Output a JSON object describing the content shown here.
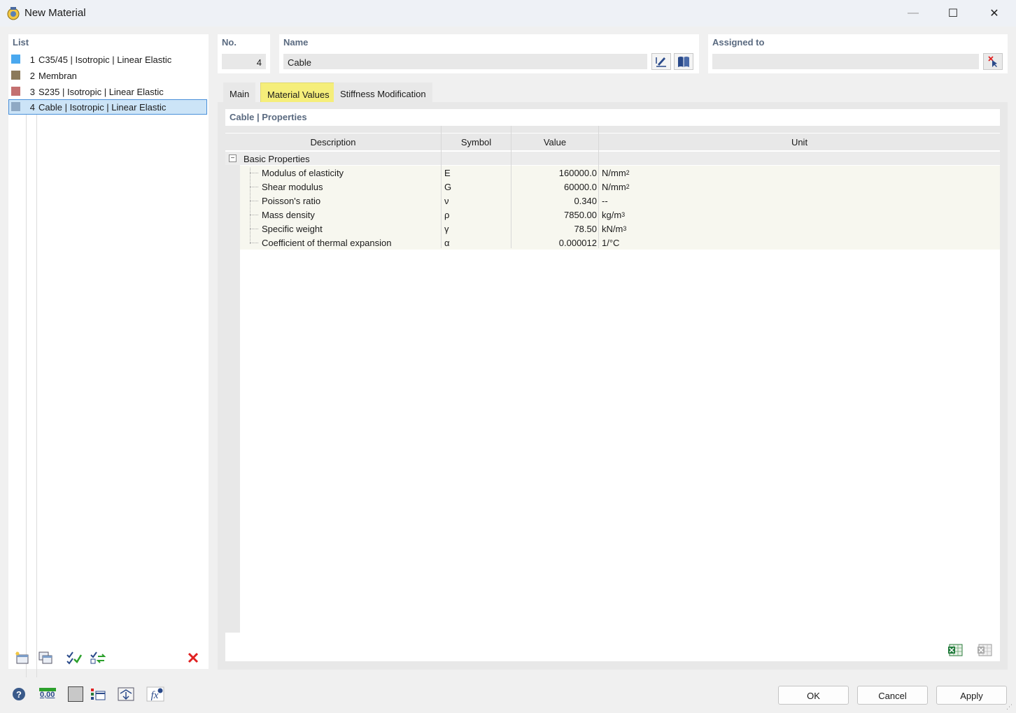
{
  "window": {
    "title": "New Material",
    "minimize": "—",
    "maximize": "☐",
    "close": "✕"
  },
  "list": {
    "label": "List",
    "items": [
      {
        "num": "1",
        "label": "C35/45 | Isotropic | Linear Elastic",
        "color": "#4aa8ef"
      },
      {
        "num": "2",
        "label": "Membran",
        "color": "#8c7a5a"
      },
      {
        "num": "3",
        "label": "S235 | Isotropic | Linear Elastic",
        "color": "#c47070"
      },
      {
        "num": "4",
        "label": "Cable | Isotropic | Linear Elastic",
        "color": "#8fa9c4"
      }
    ],
    "selected_index": 3
  },
  "no": {
    "label": "No.",
    "value": "4"
  },
  "name": {
    "label": "Name",
    "value": "Cable"
  },
  "assigned": {
    "label": "Assigned to",
    "value": ""
  },
  "tabs": [
    {
      "label": "Main",
      "active": false
    },
    {
      "label": "Material Values",
      "active": true
    },
    {
      "label": "Stiffness Modification",
      "active": false
    }
  ],
  "properties": {
    "title": "Cable | Properties",
    "columns": {
      "description": "Description",
      "symbol": "Symbol",
      "value": "Value",
      "unit": "Unit"
    },
    "group": "Basic Properties",
    "expander": "−",
    "rows": [
      {
        "desc": "Modulus of elasticity",
        "sym": "E",
        "val": "160000.0",
        "unit": "N/mm",
        "sup": "2"
      },
      {
        "desc": "Shear modulus",
        "sym": "G",
        "val": "60000.0",
        "unit": "N/mm",
        "sup": "2"
      },
      {
        "desc": "Poisson's ratio",
        "sym": "ν",
        "val": "0.340",
        "unit": "--",
        "sup": ""
      },
      {
        "desc": "Mass density",
        "sym": "ρ",
        "val": "7850.00",
        "unit": "kg/m",
        "sup": "3"
      },
      {
        "desc": "Specific weight",
        "sym": "γ",
        "val": "78.50",
        "unit": "kN/m",
        "sup": "3"
      },
      {
        "desc": "Coefficient of thermal expansion",
        "sym": "α",
        "val": "0.000012",
        "unit": "1/°C",
        "sup": ""
      }
    ]
  },
  "footer": {
    "ok": "OK",
    "cancel": "Cancel",
    "apply": "Apply",
    "units_readout": "0,00"
  },
  "colors": {
    "accent_tab": "#f5ee7a",
    "label": "#5a6a80",
    "selection": "#cce4f7",
    "delete_red": "#e02020"
  }
}
